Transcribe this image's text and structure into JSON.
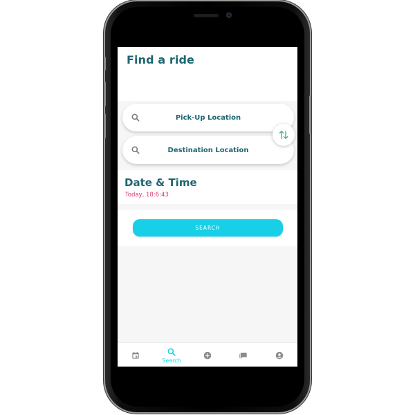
{
  "header": {
    "title": "Find a ride"
  },
  "locations": {
    "pickup_label": "Pick-Up Location",
    "destination_label": "Destination Location"
  },
  "datetime": {
    "title": "Date & Time",
    "value": "Today, 18:6:43"
  },
  "search": {
    "button_label": "SEARCH"
  },
  "bottom_nav": {
    "items": [
      {
        "icon": "calendar-icon",
        "label": "",
        "active": false
      },
      {
        "icon": "search-icon",
        "label": "Search",
        "active": true
      },
      {
        "icon": "add-circle-icon",
        "label": "",
        "active": false
      },
      {
        "icon": "chat-icon",
        "label": "",
        "active": false
      },
      {
        "icon": "account-icon",
        "label": "",
        "active": false
      }
    ]
  },
  "colors": {
    "primary_text": "#1d6670",
    "accent": "#17cfe7",
    "date_text": "#e0356a",
    "swap_icon": "#3fb57a",
    "inactive_icon": "#8c8c8c"
  }
}
